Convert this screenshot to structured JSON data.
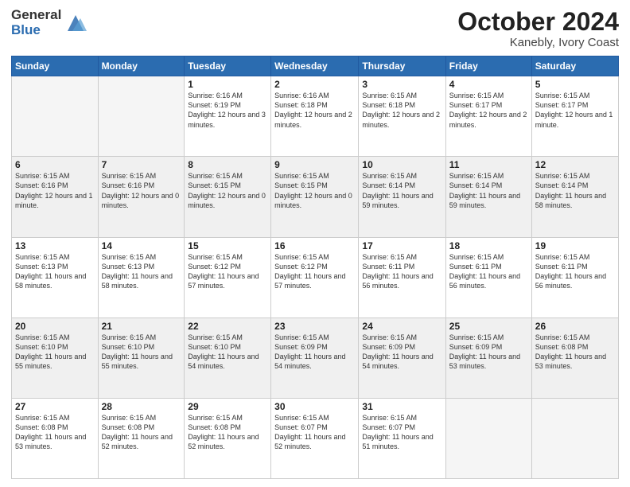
{
  "header": {
    "logo_general": "General",
    "logo_blue": "Blue",
    "title": "October 2024",
    "subtitle": "Kanebly, Ivory Coast"
  },
  "days_of_week": [
    "Sunday",
    "Monday",
    "Tuesday",
    "Wednesday",
    "Thursday",
    "Friday",
    "Saturday"
  ],
  "weeks": [
    [
      {
        "day": "",
        "sunrise": "",
        "sunset": "",
        "daylight": "",
        "empty": true
      },
      {
        "day": "",
        "sunrise": "",
        "sunset": "",
        "daylight": "",
        "empty": true
      },
      {
        "day": "1",
        "sunrise": "Sunrise: 6:16 AM",
        "sunset": "Sunset: 6:19 PM",
        "daylight": "Daylight: 12 hours and 3 minutes."
      },
      {
        "day": "2",
        "sunrise": "Sunrise: 6:16 AM",
        "sunset": "Sunset: 6:18 PM",
        "daylight": "Daylight: 12 hours and 2 minutes."
      },
      {
        "day": "3",
        "sunrise": "Sunrise: 6:15 AM",
        "sunset": "Sunset: 6:18 PM",
        "daylight": "Daylight: 12 hours and 2 minutes."
      },
      {
        "day": "4",
        "sunrise": "Sunrise: 6:15 AM",
        "sunset": "Sunset: 6:17 PM",
        "daylight": "Daylight: 12 hours and 2 minutes."
      },
      {
        "day": "5",
        "sunrise": "Sunrise: 6:15 AM",
        "sunset": "Sunset: 6:17 PM",
        "daylight": "Daylight: 12 hours and 1 minute."
      }
    ],
    [
      {
        "day": "6",
        "sunrise": "Sunrise: 6:15 AM",
        "sunset": "Sunset: 6:16 PM",
        "daylight": "Daylight: 12 hours and 1 minute."
      },
      {
        "day": "7",
        "sunrise": "Sunrise: 6:15 AM",
        "sunset": "Sunset: 6:16 PM",
        "daylight": "Daylight: 12 hours and 0 minutes."
      },
      {
        "day": "8",
        "sunrise": "Sunrise: 6:15 AM",
        "sunset": "Sunset: 6:15 PM",
        "daylight": "Daylight: 12 hours and 0 minutes."
      },
      {
        "day": "9",
        "sunrise": "Sunrise: 6:15 AM",
        "sunset": "Sunset: 6:15 PM",
        "daylight": "Daylight: 12 hours and 0 minutes."
      },
      {
        "day": "10",
        "sunrise": "Sunrise: 6:15 AM",
        "sunset": "Sunset: 6:14 PM",
        "daylight": "Daylight: 11 hours and 59 minutes."
      },
      {
        "day": "11",
        "sunrise": "Sunrise: 6:15 AM",
        "sunset": "Sunset: 6:14 PM",
        "daylight": "Daylight: 11 hours and 59 minutes."
      },
      {
        "day": "12",
        "sunrise": "Sunrise: 6:15 AM",
        "sunset": "Sunset: 6:14 PM",
        "daylight": "Daylight: 11 hours and 58 minutes."
      }
    ],
    [
      {
        "day": "13",
        "sunrise": "Sunrise: 6:15 AM",
        "sunset": "Sunset: 6:13 PM",
        "daylight": "Daylight: 11 hours and 58 minutes."
      },
      {
        "day": "14",
        "sunrise": "Sunrise: 6:15 AM",
        "sunset": "Sunset: 6:13 PM",
        "daylight": "Daylight: 11 hours and 58 minutes."
      },
      {
        "day": "15",
        "sunrise": "Sunrise: 6:15 AM",
        "sunset": "Sunset: 6:12 PM",
        "daylight": "Daylight: 11 hours and 57 minutes."
      },
      {
        "day": "16",
        "sunrise": "Sunrise: 6:15 AM",
        "sunset": "Sunset: 6:12 PM",
        "daylight": "Daylight: 11 hours and 57 minutes."
      },
      {
        "day": "17",
        "sunrise": "Sunrise: 6:15 AM",
        "sunset": "Sunset: 6:11 PM",
        "daylight": "Daylight: 11 hours and 56 minutes."
      },
      {
        "day": "18",
        "sunrise": "Sunrise: 6:15 AM",
        "sunset": "Sunset: 6:11 PM",
        "daylight": "Daylight: 11 hours and 56 minutes."
      },
      {
        "day": "19",
        "sunrise": "Sunrise: 6:15 AM",
        "sunset": "Sunset: 6:11 PM",
        "daylight": "Daylight: 11 hours and 56 minutes."
      }
    ],
    [
      {
        "day": "20",
        "sunrise": "Sunrise: 6:15 AM",
        "sunset": "Sunset: 6:10 PM",
        "daylight": "Daylight: 11 hours and 55 minutes."
      },
      {
        "day": "21",
        "sunrise": "Sunrise: 6:15 AM",
        "sunset": "Sunset: 6:10 PM",
        "daylight": "Daylight: 11 hours and 55 minutes."
      },
      {
        "day": "22",
        "sunrise": "Sunrise: 6:15 AM",
        "sunset": "Sunset: 6:10 PM",
        "daylight": "Daylight: 11 hours and 54 minutes."
      },
      {
        "day": "23",
        "sunrise": "Sunrise: 6:15 AM",
        "sunset": "Sunset: 6:09 PM",
        "daylight": "Daylight: 11 hours and 54 minutes."
      },
      {
        "day": "24",
        "sunrise": "Sunrise: 6:15 AM",
        "sunset": "Sunset: 6:09 PM",
        "daylight": "Daylight: 11 hours and 54 minutes."
      },
      {
        "day": "25",
        "sunrise": "Sunrise: 6:15 AM",
        "sunset": "Sunset: 6:09 PM",
        "daylight": "Daylight: 11 hours and 53 minutes."
      },
      {
        "day": "26",
        "sunrise": "Sunrise: 6:15 AM",
        "sunset": "Sunset: 6:08 PM",
        "daylight": "Daylight: 11 hours and 53 minutes."
      }
    ],
    [
      {
        "day": "27",
        "sunrise": "Sunrise: 6:15 AM",
        "sunset": "Sunset: 6:08 PM",
        "daylight": "Daylight: 11 hours and 53 minutes."
      },
      {
        "day": "28",
        "sunrise": "Sunrise: 6:15 AM",
        "sunset": "Sunset: 6:08 PM",
        "daylight": "Daylight: 11 hours and 52 minutes."
      },
      {
        "day": "29",
        "sunrise": "Sunrise: 6:15 AM",
        "sunset": "Sunset: 6:08 PM",
        "daylight": "Daylight: 11 hours and 52 minutes."
      },
      {
        "day": "30",
        "sunrise": "Sunrise: 6:15 AM",
        "sunset": "Sunset: 6:07 PM",
        "daylight": "Daylight: 11 hours and 52 minutes."
      },
      {
        "day": "31",
        "sunrise": "Sunrise: 6:15 AM",
        "sunset": "Sunset: 6:07 PM",
        "daylight": "Daylight: 11 hours and 51 minutes."
      },
      {
        "day": "",
        "sunrise": "",
        "sunset": "",
        "daylight": "",
        "empty": true
      },
      {
        "day": "",
        "sunrise": "",
        "sunset": "",
        "daylight": "",
        "empty": true
      }
    ]
  ]
}
